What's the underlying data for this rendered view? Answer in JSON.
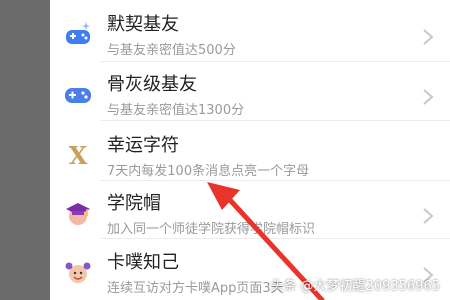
{
  "items": [
    {
      "title": "默契基友",
      "desc": "与基友亲密值达500分",
      "icon": "gamepad-sparkle-icon"
    },
    {
      "title": "骨灰级基友",
      "desc": "与基友亲密值达1300分",
      "icon": "gamepad-icon"
    },
    {
      "title": "幸运字符",
      "desc": "7天内每发100条消息点亮一个字母",
      "icon": "letter-x-icon"
    },
    {
      "title": "学院帽",
      "desc": "加入同一个师徒学院获得学院帽标识",
      "icon": "graduation-cap-icon"
    },
    {
      "title": "卡噗知己",
      "desc": "连续互访对方卡噗App页面3天",
      "icon": "cheer-face-icon"
    }
  ],
  "watermark": "头条 @大梦初醒209356965",
  "colors": {
    "accent": "#e8342a",
    "background": "#6b6b6b"
  }
}
